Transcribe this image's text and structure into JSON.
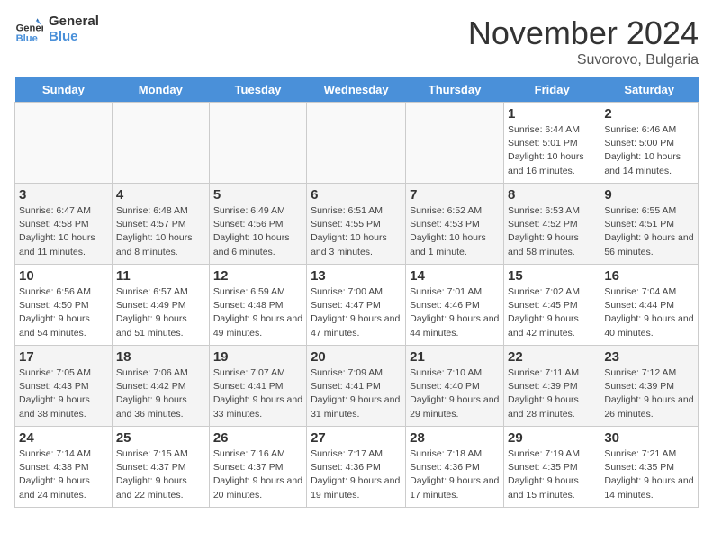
{
  "header": {
    "logo_line1": "General",
    "logo_line2": "Blue",
    "month_title": "November 2024",
    "location": "Suvorovo, Bulgaria"
  },
  "days_of_week": [
    "Sunday",
    "Monday",
    "Tuesday",
    "Wednesday",
    "Thursday",
    "Friday",
    "Saturday"
  ],
  "weeks": [
    [
      {
        "day": null
      },
      {
        "day": null
      },
      {
        "day": null
      },
      {
        "day": null
      },
      {
        "day": null
      },
      {
        "day": 1,
        "info": "Sunrise: 6:44 AM\nSunset: 5:01 PM\nDaylight: 10 hours and 16 minutes."
      },
      {
        "day": 2,
        "info": "Sunrise: 6:46 AM\nSunset: 5:00 PM\nDaylight: 10 hours and 14 minutes."
      }
    ],
    [
      {
        "day": 3,
        "info": "Sunrise: 6:47 AM\nSunset: 4:58 PM\nDaylight: 10 hours and 11 minutes."
      },
      {
        "day": 4,
        "info": "Sunrise: 6:48 AM\nSunset: 4:57 PM\nDaylight: 10 hours and 8 minutes."
      },
      {
        "day": 5,
        "info": "Sunrise: 6:49 AM\nSunset: 4:56 PM\nDaylight: 10 hours and 6 minutes."
      },
      {
        "day": 6,
        "info": "Sunrise: 6:51 AM\nSunset: 4:55 PM\nDaylight: 10 hours and 3 minutes."
      },
      {
        "day": 7,
        "info": "Sunrise: 6:52 AM\nSunset: 4:53 PM\nDaylight: 10 hours and 1 minute."
      },
      {
        "day": 8,
        "info": "Sunrise: 6:53 AM\nSunset: 4:52 PM\nDaylight: 9 hours and 58 minutes."
      },
      {
        "day": 9,
        "info": "Sunrise: 6:55 AM\nSunset: 4:51 PM\nDaylight: 9 hours and 56 minutes."
      }
    ],
    [
      {
        "day": 10,
        "info": "Sunrise: 6:56 AM\nSunset: 4:50 PM\nDaylight: 9 hours and 54 minutes."
      },
      {
        "day": 11,
        "info": "Sunrise: 6:57 AM\nSunset: 4:49 PM\nDaylight: 9 hours and 51 minutes."
      },
      {
        "day": 12,
        "info": "Sunrise: 6:59 AM\nSunset: 4:48 PM\nDaylight: 9 hours and 49 minutes."
      },
      {
        "day": 13,
        "info": "Sunrise: 7:00 AM\nSunset: 4:47 PM\nDaylight: 9 hours and 47 minutes."
      },
      {
        "day": 14,
        "info": "Sunrise: 7:01 AM\nSunset: 4:46 PM\nDaylight: 9 hours and 44 minutes."
      },
      {
        "day": 15,
        "info": "Sunrise: 7:02 AM\nSunset: 4:45 PM\nDaylight: 9 hours and 42 minutes."
      },
      {
        "day": 16,
        "info": "Sunrise: 7:04 AM\nSunset: 4:44 PM\nDaylight: 9 hours and 40 minutes."
      }
    ],
    [
      {
        "day": 17,
        "info": "Sunrise: 7:05 AM\nSunset: 4:43 PM\nDaylight: 9 hours and 38 minutes."
      },
      {
        "day": 18,
        "info": "Sunrise: 7:06 AM\nSunset: 4:42 PM\nDaylight: 9 hours and 36 minutes."
      },
      {
        "day": 19,
        "info": "Sunrise: 7:07 AM\nSunset: 4:41 PM\nDaylight: 9 hours and 33 minutes."
      },
      {
        "day": 20,
        "info": "Sunrise: 7:09 AM\nSunset: 4:41 PM\nDaylight: 9 hours and 31 minutes."
      },
      {
        "day": 21,
        "info": "Sunrise: 7:10 AM\nSunset: 4:40 PM\nDaylight: 9 hours and 29 minutes."
      },
      {
        "day": 22,
        "info": "Sunrise: 7:11 AM\nSunset: 4:39 PM\nDaylight: 9 hours and 28 minutes."
      },
      {
        "day": 23,
        "info": "Sunrise: 7:12 AM\nSunset: 4:39 PM\nDaylight: 9 hours and 26 minutes."
      }
    ],
    [
      {
        "day": 24,
        "info": "Sunrise: 7:14 AM\nSunset: 4:38 PM\nDaylight: 9 hours and 24 minutes."
      },
      {
        "day": 25,
        "info": "Sunrise: 7:15 AM\nSunset: 4:37 PM\nDaylight: 9 hours and 22 minutes."
      },
      {
        "day": 26,
        "info": "Sunrise: 7:16 AM\nSunset: 4:37 PM\nDaylight: 9 hours and 20 minutes."
      },
      {
        "day": 27,
        "info": "Sunrise: 7:17 AM\nSunset: 4:36 PM\nDaylight: 9 hours and 19 minutes."
      },
      {
        "day": 28,
        "info": "Sunrise: 7:18 AM\nSunset: 4:36 PM\nDaylight: 9 hours and 17 minutes."
      },
      {
        "day": 29,
        "info": "Sunrise: 7:19 AM\nSunset: 4:35 PM\nDaylight: 9 hours and 15 minutes."
      },
      {
        "day": 30,
        "info": "Sunrise: 7:21 AM\nSunset: 4:35 PM\nDaylight: 9 hours and 14 minutes."
      }
    ]
  ],
  "colors": {
    "header_bg": "#4a90d9",
    "alt_row": "#f4f4f4",
    "normal_row": "#ffffff"
  }
}
